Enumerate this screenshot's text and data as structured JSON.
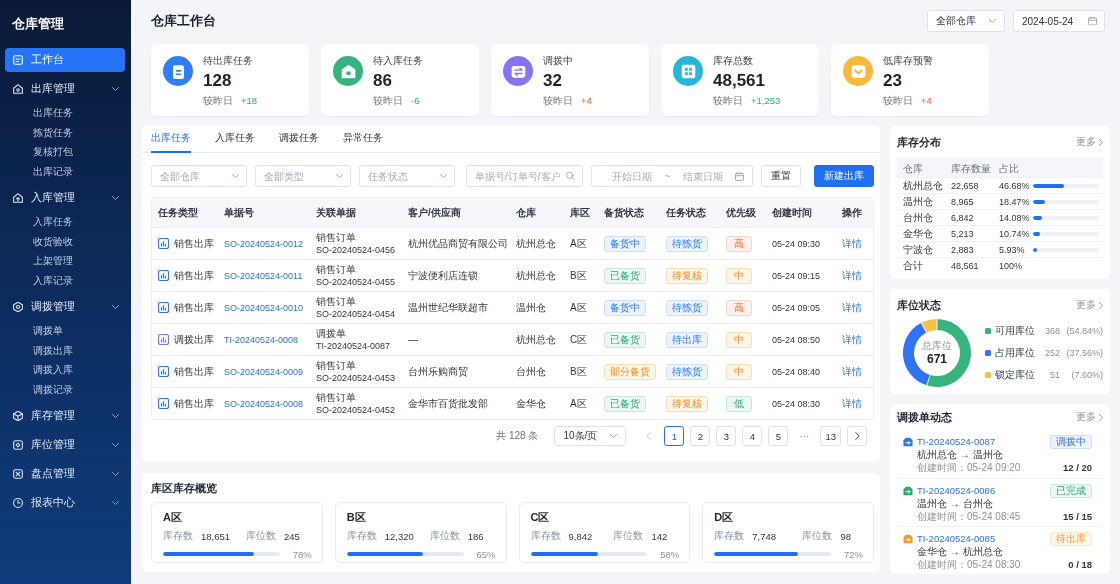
{
  "sidebar": {
    "title": "仓库管理",
    "items": [
      {
        "kind": "page",
        "label": "工作台",
        "selected": true
      },
      {
        "kind": "group",
        "label": "出库管理",
        "selected": false,
        "children": [
          {
            "label": "出库任务",
            "selected": false
          },
          {
            "label": "拣货任务",
            "selected": false
          },
          {
            "label": "复核打包",
            "selected": false
          },
          {
            "label": "出库记录",
            "selected": false
          }
        ]
      },
      {
        "kind": "group",
        "label": "入库管理",
        "selected": false,
        "children": [
          {
            "label": "入库任务",
            "selected": false
          },
          {
            "label": "收货验收",
            "selected": false
          },
          {
            "label": "上架管理",
            "selected": false
          },
          {
            "label": "入库记录",
            "selected": false
          }
        ]
      },
      {
        "kind": "group",
        "label": "调拨管理",
        "selected": false,
        "children": [
          {
            "label": "调拨单",
            "selected": false
          },
          {
            "label": "调拨出库",
            "selected": false
          },
          {
            "label": "调拨入库",
            "selected": false
          },
          {
            "label": "调拨记录",
            "selected": false
          }
        ]
      },
      {
        "kind": "group",
        "label": "库存管理",
        "selected": false
      },
      {
        "kind": "group",
        "label": "库位管理",
        "selected": false
      },
      {
        "kind": "group",
        "label": "盘点管理",
        "selected": false
      },
      {
        "kind": "group",
        "label": "报表中心",
        "selected": false
      }
    ]
  },
  "header": {
    "title": "仓库工作台",
    "warehouse_select": {
      "value": "全部仓库"
    },
    "date_field": {
      "value": "2024-05-24"
    }
  },
  "stats": [
    {
      "label": "待出库任务",
      "value": "128",
      "compare_label": "较昨日",
      "delta": {
        "text": "+18",
        "kind": "positive"
      },
      "color": "#2f7ef6"
    },
    {
      "label": "待入库任务",
      "value": "86",
      "compare_label": "较昨日",
      "delta": {
        "text": "-6",
        "kind": "positive"
      },
      "color": "#34b37e"
    },
    {
      "label": "调拨中",
      "value": "32",
      "compare_label": "较昨日",
      "delta": {
        "text": "+4",
        "kind": "warning"
      },
      "color": "#8873f2"
    },
    {
      "label": "库存总数",
      "value": "48,561",
      "compare_label": "较昨日",
      "delta": {
        "text": "+1,253",
        "kind": "positive"
      },
      "color": "#25b6d8"
    },
    {
      "label": "低库存预警",
      "value": "23",
      "compare_label": "较昨日",
      "delta": {
        "text": "+4",
        "kind": "warning"
      },
      "color": "#f6b93c"
    }
  ],
  "tasks": {
    "tabs": [
      {
        "label": "出库任务",
        "selected": true
      },
      {
        "label": "入库任务",
        "selected": false
      },
      {
        "label": "调拨任务",
        "selected": false
      },
      {
        "label": "异常任务",
        "selected": false
      }
    ],
    "filters": [
      {
        "kind": "select",
        "placeholder": "全部仓库"
      },
      {
        "kind": "select",
        "placeholder": "全部类型"
      },
      {
        "kind": "select",
        "placeholder": "任务状态"
      },
      {
        "kind": "search",
        "placeholder": "单据号/订单号/客户"
      },
      {
        "kind": "date_range",
        "placeholder": "开始日期",
        "separator": "~",
        "end_placeholder": "结束日期"
      }
    ],
    "buttons": [
      {
        "kind": "default",
        "label": "重置"
      },
      {
        "kind": "primary",
        "label": "新建出库"
      }
    ],
    "table": {
      "columns": [
        "任务类型",
        "单据号",
        "关联单据",
        "客户/供应商",
        "仓库",
        "库区",
        "备货状态",
        "任务状态",
        "优先级",
        "创建时间",
        "操作"
      ],
      "rows": [
        {
          "kind": "sale",
          "type": "销售出库",
          "doc_no": "SO-20240524-0012",
          "ref_type": "销售订单",
          "ref_no": "SO-20240524-0456",
          "party": "杭州优品商贸有限公司",
          "warehouse": "杭州总仓",
          "zone": "A区",
          "stock_status": {
            "text": "备货中",
            "kind": "info"
          },
          "task_status": {
            "text": "待拣货",
            "kind": "info"
          },
          "priority": {
            "text": "高",
            "kind": "danger"
          },
          "created": "05-24 09:30",
          "action": "详情"
        },
        {
          "kind": "sale",
          "type": "销售出库",
          "doc_no": "SO-20240524-0011",
          "ref_type": "销售订单",
          "ref_no": "SO-20240524-0455",
          "party": "宁波便利店连锁",
          "warehouse": "杭州总仓",
          "zone": "B区",
          "stock_status": {
            "text": "已备货",
            "kind": "success"
          },
          "task_status": {
            "text": "待复核",
            "kind": "warning"
          },
          "priority": {
            "text": "中",
            "kind": "warning"
          },
          "created": "05-24 09:15",
          "action": "详情"
        },
        {
          "kind": "sale",
          "type": "销售出库",
          "doc_no": "SO-20240524-0010",
          "ref_type": "销售订单",
          "ref_no": "SO-20240524-0454",
          "party": "温州世纪华联超市",
          "warehouse": "温州仓",
          "zone": "A区",
          "stock_status": {
            "text": "备货中",
            "kind": "info"
          },
          "task_status": {
            "text": "待拣货",
            "kind": "info"
          },
          "priority": {
            "text": "高",
            "kind": "danger"
          },
          "created": "05-24 09:05",
          "action": "详情"
        },
        {
          "kind": "transfer",
          "type": "调拨出库",
          "doc_no": "TI-20240524-0008",
          "ref_type": "调拨单",
          "ref_no": "TI-20240524-0087",
          "party": "—",
          "warehouse": "杭州总仓",
          "zone": "C区",
          "stock_status": {
            "text": "已备货",
            "kind": "success"
          },
          "task_status": {
            "text": "待出库",
            "kind": "info"
          },
          "priority": {
            "text": "中",
            "kind": "warning"
          },
          "created": "05-24 08:50",
          "action": "详情"
        },
        {
          "kind": "sale",
          "type": "销售出库",
          "doc_no": "SO-20240524-0009",
          "ref_type": "销售订单",
          "ref_no": "SO-20240524-0453",
          "party": "台州乐购商贸",
          "warehouse": "台州仓",
          "zone": "B区",
          "stock_status": {
            "text": "部分备货",
            "kind": "warning"
          },
          "task_status": {
            "text": "待拣货",
            "kind": "info"
          },
          "priority": {
            "text": "中",
            "kind": "warning"
          },
          "created": "05-24 08:40",
          "action": "详情"
        },
        {
          "kind": "sale",
          "type": "销售出库",
          "doc_no": "SO-20240524-0008",
          "ref_type": "销售订单",
          "ref_no": "SO-20240524-0452",
          "party": "金华市百货批发部",
          "warehouse": "金华仓",
          "zone": "A区",
          "stock_status": {
            "text": "已备货",
            "kind": "success"
          },
          "task_status": {
            "text": "待复核",
            "kind": "warning"
          },
          "priority": {
            "text": "低",
            "kind": "success"
          },
          "created": "05-24 08:30",
          "action": "详情"
        }
      ]
    },
    "pagination": {
      "total": "共 128 条",
      "page_size": "10条/页",
      "prev": {
        "disabled": true
      },
      "pages": [
        {
          "kind": "page",
          "label": "1",
          "selected": true
        },
        {
          "kind": "page",
          "label": "2",
          "selected": false
        },
        {
          "kind": "page",
          "label": "3",
          "selected": false
        },
        {
          "kind": "page",
          "label": "4",
          "selected": false
        },
        {
          "kind": "page",
          "label": "5",
          "selected": false
        },
        {
          "kind": "ellipsis",
          "label": "···"
        },
        {
          "kind": "page",
          "label": "13",
          "selected": false
        }
      ],
      "next": {
        "disabled": false
      }
    }
  },
  "zones": {
    "title": "库区库存概览",
    "items": [
      {
        "name": "A区",
        "stock_label": "库存数",
        "stock": "18,651",
        "bins_label": "库位数",
        "bins": "245",
        "level": 0.78,
        "percent": "78%"
      },
      {
        "name": "B区",
        "stock_label": "库存数",
        "stock": "12,320",
        "bins_label": "库位数",
        "bins": "186",
        "level": 0.65,
        "percent": "65%"
      },
      {
        "name": "C区",
        "stock_label": "库存数",
        "stock": "9,842",
        "bins_label": "库位数",
        "bins": "142",
        "level": 0.58,
        "percent": "58%"
      },
      {
        "name": "D区",
        "stock_label": "库存数",
        "stock": "7,748",
        "bins_label": "库位数",
        "bins": "98",
        "level": 0.72,
        "percent": "72%"
      }
    ]
  },
  "distribution": {
    "title": "库存分布",
    "more": "更多",
    "columns": [
      "仓库",
      "库存数量",
      "占比"
    ],
    "rows": [
      {
        "warehouse": "杭州总仓",
        "quantity": "22,658",
        "share": "46.68%",
        "level": 0.4668
      },
      {
        "warehouse": "温州仓",
        "quantity": "8,965",
        "share": "18.47%",
        "level": 0.1847
      },
      {
        "warehouse": "台州仓",
        "quantity": "6,842",
        "share": "14.08%",
        "level": 0.1408
      },
      {
        "warehouse": "金华仓",
        "quantity": "5,213",
        "share": "10.74%",
        "level": 0.1074
      },
      {
        "warehouse": "宁波仓",
        "quantity": "2,883",
        "share": "5.93%",
        "level": 0.0593
      },
      {
        "warehouse": "合计",
        "quantity": "48,561",
        "share": "100%"
      }
    ]
  },
  "bins": {
    "title": "库位状态",
    "more": "更多",
    "center_label": "总库位",
    "center_value": "671",
    "chart_data": {
      "type": "donut",
      "categories": [
        "可用库位",
        "占用库位",
        "锁定库位"
      ],
      "values": [
        54.84,
        37.56,
        7.6
      ]
    },
    "legend": [
      {
        "count": "368",
        "share": "(54.84%)",
        "color": "#37b47e"
      },
      {
        "count": "252",
        "share": "(37.56%)",
        "color": "#2f74f2"
      },
      {
        "count": "51",
        "share": "(7.60%)",
        "color": "#f7c144"
      }
    ]
  },
  "transfers": {
    "title": "调拨单动态",
    "more": "更多",
    "items": [
      {
        "doc_no": "TI-20240524-0087",
        "status": "调拨中",
        "color": "#2f74f2",
        "route": "杭州总仓 → 温州仓",
        "created": "创建时间：05-24 09:20",
        "progress": "12 / 20"
      },
      {
        "doc_no": "TI-20240524-0086",
        "status": "已完成",
        "color": "#2ea56b",
        "route": "温州仓 → 台州仓",
        "created": "创建时间：05-24 08:45",
        "progress": "15 / 15"
      },
      {
        "doc_no": "TI-20240524-0085",
        "status": "待出库",
        "color": "#f39a2c",
        "route": "金华仓 → 杭州总仓",
        "created": "创建时间：05-24 08:30",
        "progress": "0 / 18"
      }
    ]
  }
}
